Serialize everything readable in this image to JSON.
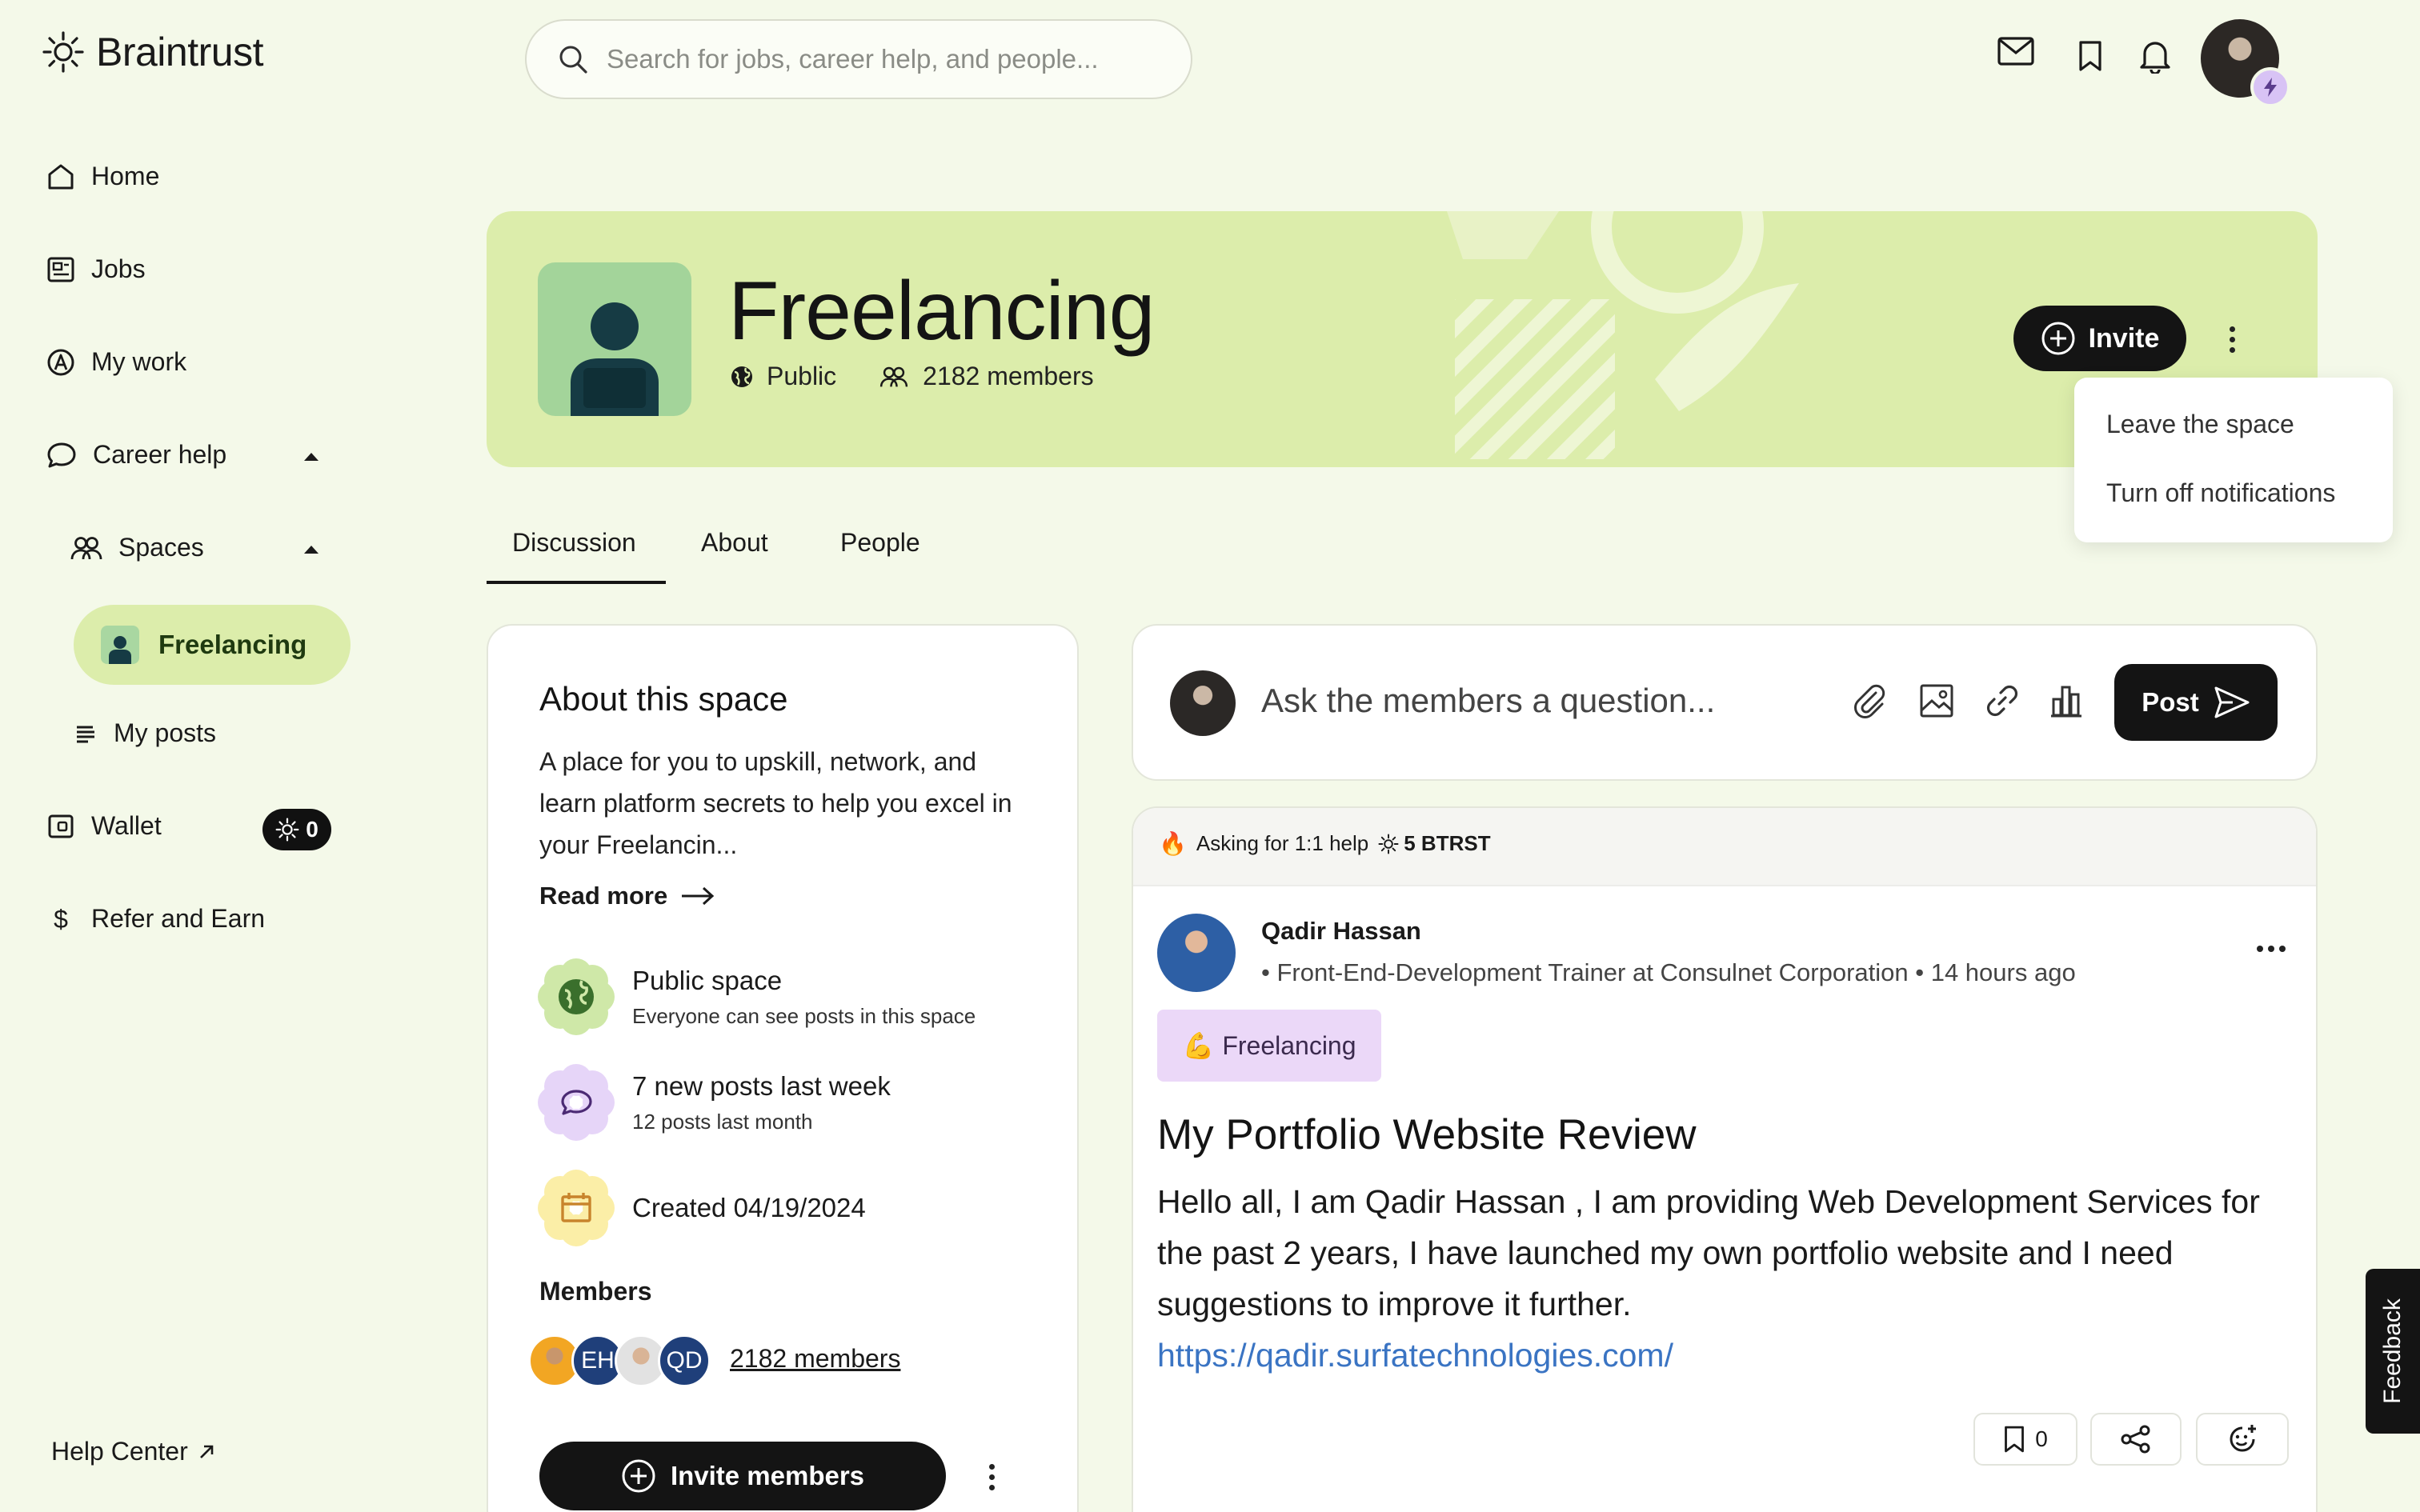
{
  "brand": {
    "name": "Braintrust"
  },
  "search": {
    "placeholder": "Search for jobs, career help, and people..."
  },
  "header_icons": [
    "mail-icon",
    "bookmark-icon",
    "bell-icon"
  ],
  "sidebar": {
    "items": [
      {
        "label": "Home",
        "icon": "home-icon"
      },
      {
        "label": "Jobs",
        "icon": "jobs-icon"
      },
      {
        "label": "My work",
        "icon": "my-work-icon"
      },
      {
        "label": "Career help",
        "icon": "chat-icon"
      },
      {
        "label": "Spaces",
        "icon": "people-icon"
      },
      {
        "label": "Freelancing",
        "icon": "space-avatar-icon"
      },
      {
        "label": "My posts",
        "icon": "list-icon"
      },
      {
        "label": "Wallet",
        "icon": "wallet-icon"
      },
      {
        "label": "Refer and Earn",
        "icon": "dollar-icon"
      }
    ],
    "wallet_balance": "0",
    "help_center": "Help Center"
  },
  "space": {
    "title": "Freelancing",
    "visibility": "Public",
    "members": "2182 members",
    "invite_label": "Invite"
  },
  "menu": {
    "items": [
      "Leave the space",
      "Turn off notifications"
    ]
  },
  "tabs": [
    {
      "label": "Discussion",
      "active": true
    },
    {
      "label": "About",
      "active": false
    },
    {
      "label": "People",
      "active": false
    }
  ],
  "about": {
    "title": "About this space",
    "description": "A place for you to upskill, network, and learn platform secrets to help you excel in your Freelancin...",
    "read_more": "Read more",
    "features": [
      {
        "title": "Public space",
        "subtitle": "Everyone can see posts in this space"
      },
      {
        "title": "7 new posts last week",
        "subtitle": "12 posts last month"
      },
      {
        "title": "Created 04/19/2024",
        "subtitle": ""
      }
    ],
    "members_label": "Members",
    "member_initials": [
      "EH",
      "QD"
    ],
    "members_link": "2182 members",
    "invite_members": "Invite members"
  },
  "composer": {
    "placeholder": "Ask the members a question...",
    "post_label": "Post"
  },
  "post": {
    "strip_text": "Asking for 1:1 help",
    "strip_reward": "5 BTRST",
    "author": "Qadir Hassan",
    "author_meta": "• Front-End-Development Trainer at Consulnet Corporation • 14 hours ago",
    "tag": "Freelancing",
    "tag_emoji": "💪",
    "title": "My Portfolio Website Review",
    "body": "Hello all, I am Qadir Hassan , I am providing Web Development Services for the past 2 years, I have launched my own portfolio website and I need suggestions to improve it further.",
    "link": "https://qadir.surfatechnologies.com/",
    "bookmark_count": "0"
  },
  "feedback": "Feedback",
  "colors": {
    "background": "#f4f9e9",
    "banner": "#dcedab",
    "dark": "#141414",
    "tag": "#ebd8f8",
    "link": "#3a74c3"
  }
}
